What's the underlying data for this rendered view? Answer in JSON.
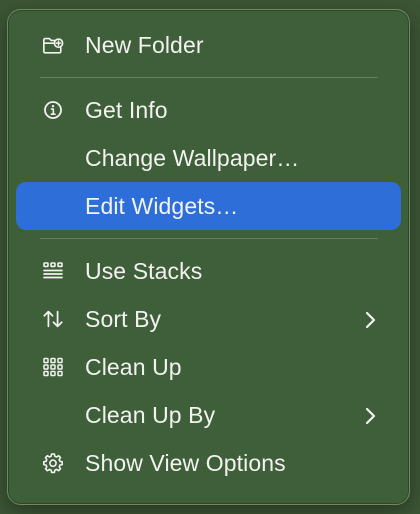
{
  "menu": {
    "items": [
      {
        "label": "New Folder",
        "icon": "new-folder-icon"
      },
      {
        "label": "Get Info",
        "icon": "info-icon"
      },
      {
        "label": "Change Wallpaper…",
        "icon": ""
      },
      {
        "label": "Edit Widgets…",
        "icon": "",
        "highlighted": true
      },
      {
        "label": "Use Stacks",
        "icon": "stacks-icon"
      },
      {
        "label": "Sort By",
        "icon": "sort-arrows-icon",
        "submenu": true
      },
      {
        "label": "Clean Up",
        "icon": "grid-icon"
      },
      {
        "label": "Clean Up By",
        "icon": "",
        "submenu": true
      },
      {
        "label": "Show View Options",
        "icon": "gear-icon"
      }
    ]
  },
  "colors": {
    "menu_background": "#3f5e3a",
    "highlight": "#2d6ed9",
    "text": "#f2f3ef",
    "separator": "#66805c"
  }
}
